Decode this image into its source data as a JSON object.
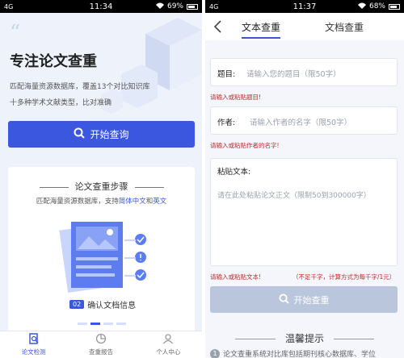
{
  "left": {
    "status": {
      "signal": "4G",
      "time": "11:34",
      "battery": "69%"
    },
    "title": "专注论文查重",
    "desc_line1": "匹配海量资源数据库，覆盖13个对比知识库",
    "desc_line2": "十多种学术文献类型，比对准确",
    "start_button": "开始查询",
    "card": {
      "title": "论文查重步骤",
      "desc_prefix": "匹配海量资源数据库，支持",
      "desc_hl1": "简体中文",
      "desc_mid": "和",
      "desc_hl2": "英文",
      "step_num": "02",
      "step_label": "确认文档信息"
    },
    "tabs": [
      {
        "label": "论文检测"
      },
      {
        "label": "查重报告"
      },
      {
        "label": "个人中心"
      }
    ]
  },
  "right": {
    "status": {
      "signal": "4G",
      "time": "11:37",
      "battery": "68%"
    },
    "tab1": "文本查重",
    "tab2": "文档查重",
    "title_label": "题目:",
    "title_placeholder": "请输入您的题目（限50字）",
    "title_error": "请输入或粘贴题目!",
    "author_label": "作者:",
    "author_placeholder": "请输入作者的名字（限50字）",
    "author_error": "请输入或粘贴作者的名字!",
    "text_label": "粘贴文本:",
    "text_placeholder": "请在此处粘贴论文正文（限制50到300000字）",
    "text_error": "请输入或粘贴文本!",
    "text_note": "（不足千字，计算方式为每千字/1元）",
    "check_button": "开始查重",
    "tips_title": "温馨提示",
    "tip1_num": "1",
    "tip1_text": "论文查重系统对比库包括期刊核心数据库、学位"
  },
  "colors": {
    "accent": "#3b57e0",
    "error": "#c22a2a",
    "disabled": "#b9c6dc"
  }
}
